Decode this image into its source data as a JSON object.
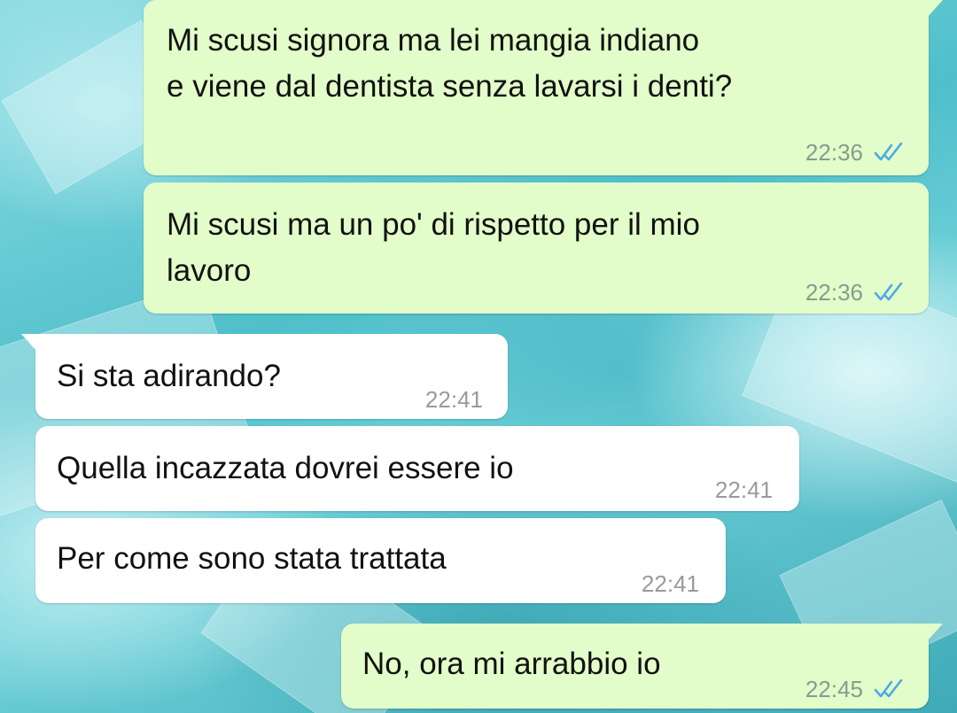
{
  "chat": {
    "messages": [
      {
        "direction": "outgoing",
        "text": "Mi scusi signora ma lei mangia indiano\ne viene dal dentista senza lavarsi i denti?",
        "time": "22:36",
        "status_icon": "double-check-read-icon"
      },
      {
        "direction": "outgoing",
        "text": "Mi scusi ma un po' di rispetto per il mio\nlavoro",
        "time": "22:36",
        "status_icon": "double-check-read-icon"
      },
      {
        "direction": "incoming",
        "text": "Si sta adirando?",
        "time": "22:41"
      },
      {
        "direction": "incoming",
        "text": "Quella incazzata dovrei essere io",
        "time": "22:41"
      },
      {
        "direction": "incoming",
        "text": "Per come sono stata trattata",
        "time": "22:41"
      },
      {
        "direction": "outgoing",
        "text": "No, ora mi arrabbio io",
        "time": "22:45",
        "status_icon": "double-check-read-icon"
      }
    ]
  },
  "colors": {
    "outgoing_bubble": "#e2fdc9",
    "incoming_bubble": "#ffffff",
    "read_check": "#4fa8e8",
    "wallpaper": "#5ec9d3"
  }
}
